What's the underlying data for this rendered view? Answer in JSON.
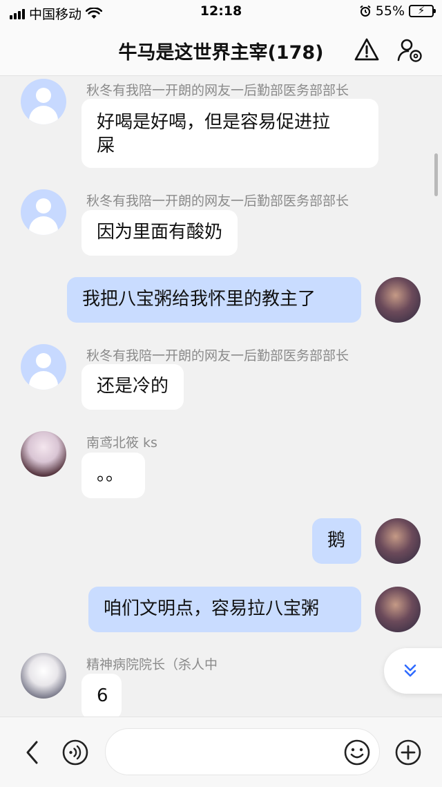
{
  "status_bar": {
    "carrier": "中国移动",
    "time": "12:18",
    "battery": "55%",
    "battery_level": 0.55
  },
  "header": {
    "title": "牛马是这世界主宰(178)"
  },
  "messages": [
    {
      "sender": "秋冬有我陪一开朗的网友一后勤部医务部部长",
      "text_line1": "好喝是好喝，但是容易促进拉",
      "text_line2": "屎",
      "avatar": "default-avatar"
    },
    {
      "sender": "秋冬有我陪一开朗的网友一后勤部医务部部长",
      "text": "因为里面有酸奶",
      "avatar": "default-avatar"
    },
    {
      "text": "我把八宝粥给我怀里的教主了",
      "avatar": "self-avatar"
    },
    {
      "sender": "秋冬有我陪一开朗的网友一后勤部医务部部长",
      "text": "还是冷的",
      "avatar": "default-avatar"
    },
    {
      "sender": "南鸢北筱 ks",
      "text": "。。",
      "avatar": "anime-girl-avatar"
    },
    {
      "text": "鹅",
      "avatar": "self-avatar"
    },
    {
      "text": "咱们文明点，容易拉八宝粥",
      "avatar": "self-avatar"
    },
    {
      "sender": "精神病院院长（杀人中",
      "text": "6",
      "avatar": "white-hair-avatar"
    }
  ],
  "input": {
    "placeholder": ""
  },
  "icons": {
    "back": "chevron-left-icon",
    "voice": "voice-icon",
    "emoji": "emoji-icon",
    "add": "plus-circle-icon",
    "warning": "warning-icon",
    "group_settings": "group-settings-icon",
    "scroll_down": "double-chevron-down-icon"
  },
  "colors": {
    "outgoing_bubble": "#c9dcff",
    "incoming_bubble": "#ffffff",
    "background": "#f1f1f1",
    "accent": "#2f6bff"
  }
}
